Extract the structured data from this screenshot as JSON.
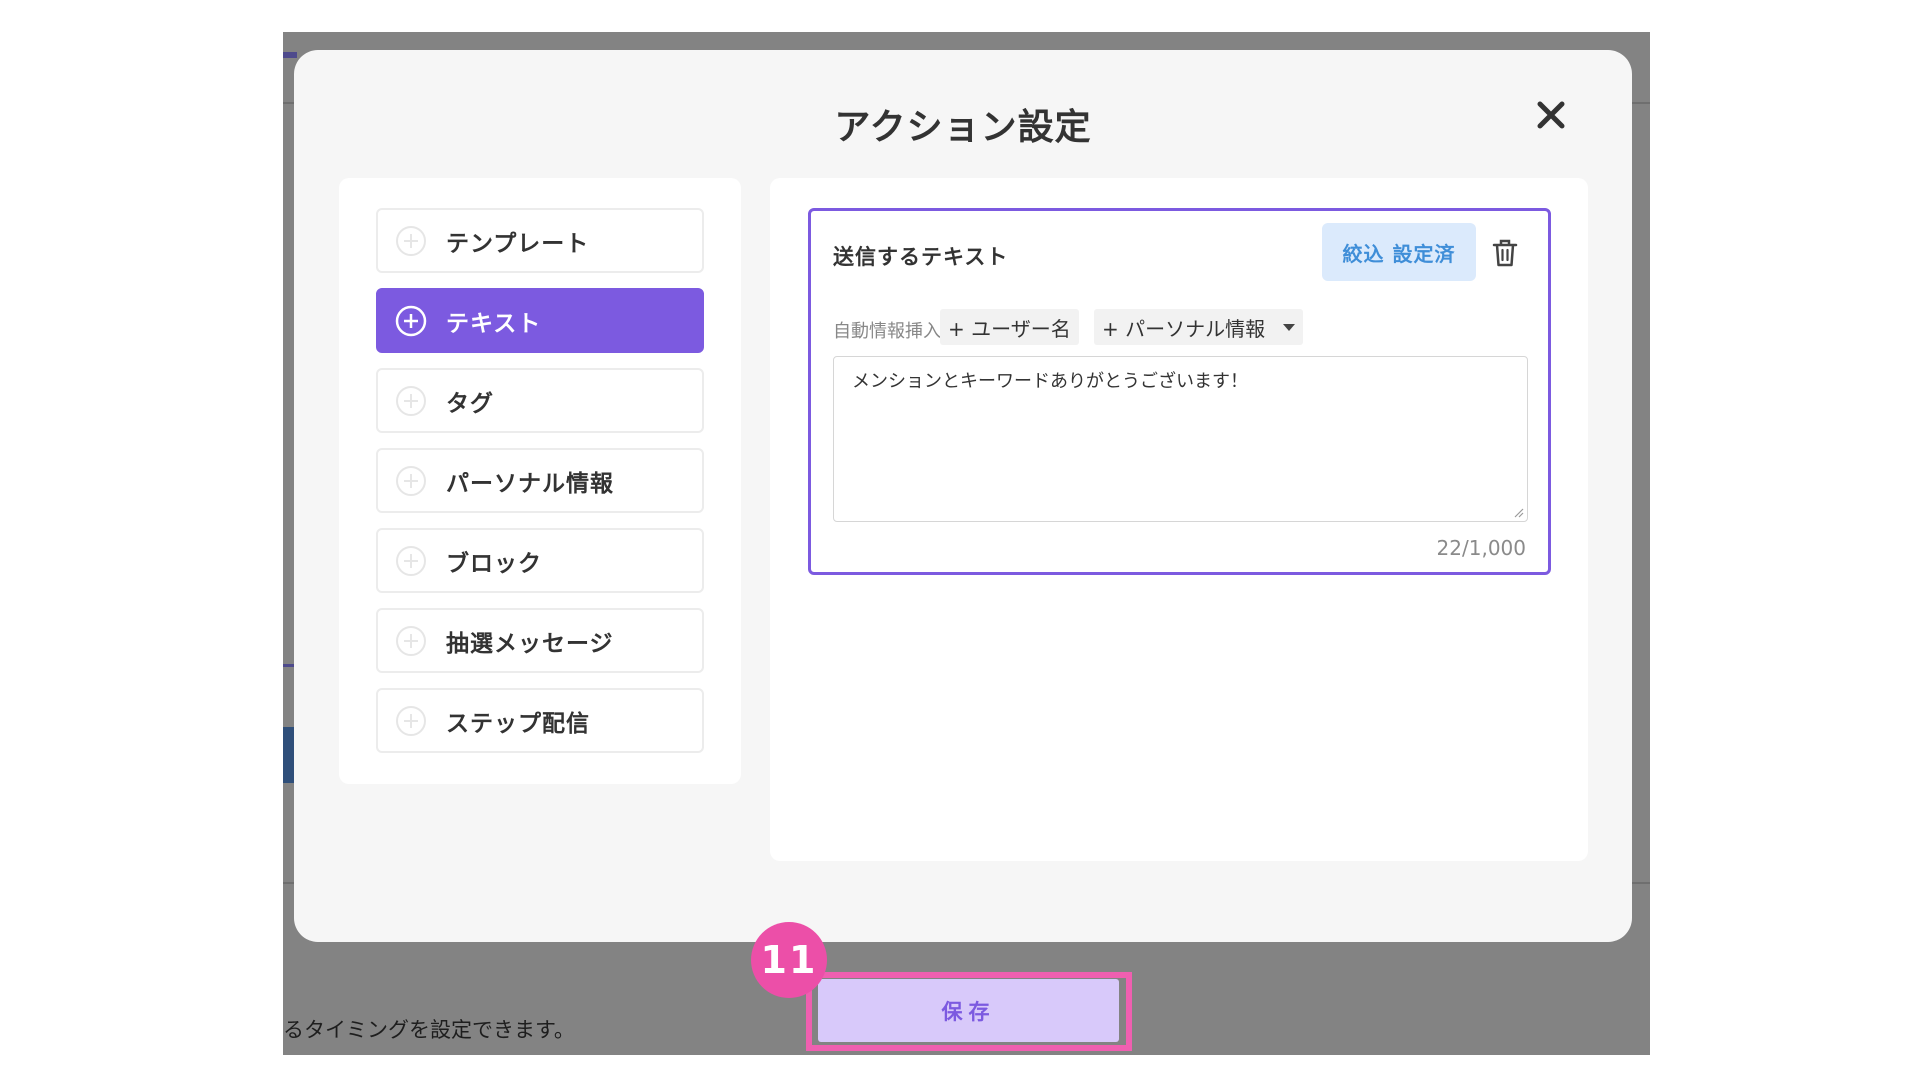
{
  "background": {
    "caption": "るタイミングを設定できます。"
  },
  "modal": {
    "title": "アクション設定",
    "close_icon": "close-icon"
  },
  "menu": {
    "items": [
      {
        "label": "テンプレート",
        "active": false
      },
      {
        "label": "テキスト",
        "active": true
      },
      {
        "label": "タグ",
        "active": false
      },
      {
        "label": "パーソナル情報",
        "active": false
      },
      {
        "label": "ブロック",
        "active": false
      },
      {
        "label": "抽選メッセージ",
        "active": false
      },
      {
        "label": "ステップ配信",
        "active": false
      }
    ]
  },
  "text_card": {
    "title": "送信するテキスト",
    "filter_button": "絞込 設定済",
    "delete_icon": "trash-icon",
    "auto_insert_label": "自動情報挿入",
    "chip_user_name": "+ ユーザー名",
    "chip_personal_info": "+ パーソナル情報",
    "message": "メンションとキーワードありがとうございます！",
    "counter": "22/1,000"
  },
  "footer": {
    "save_label": "保存",
    "step_badge": "11"
  },
  "colors": {
    "accent": "#7c5ae0",
    "annotation": "#ec4fa8",
    "filter_bg": "#dbeafc",
    "filter_text": "#3f8ed8"
  }
}
